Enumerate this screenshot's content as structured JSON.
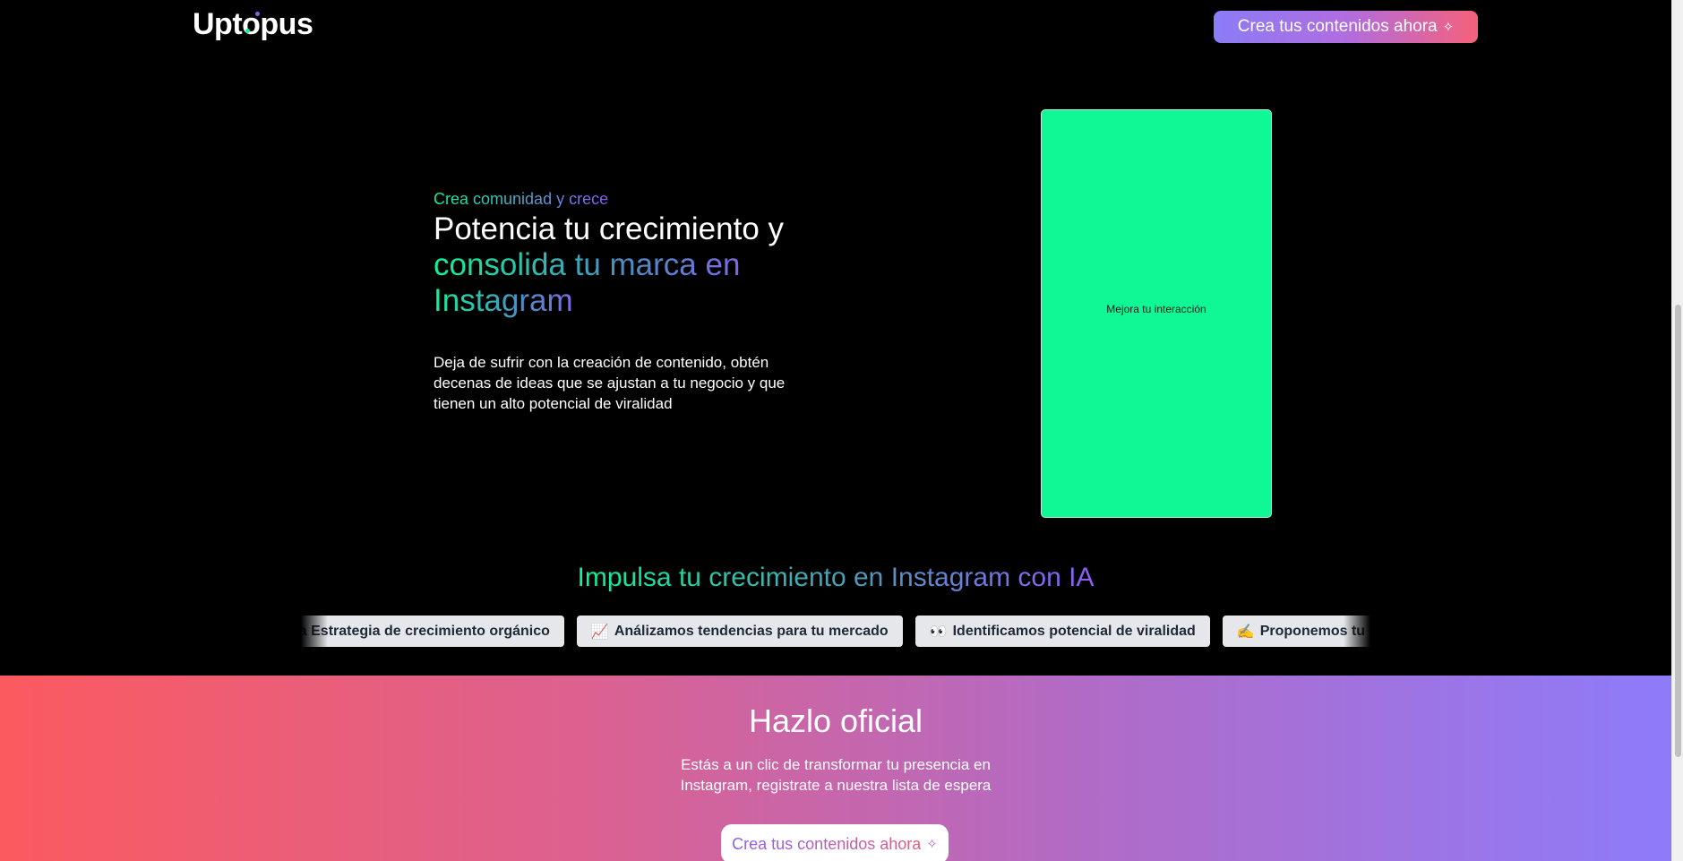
{
  "header": {
    "logo": "Uptopus",
    "cta_label": "Crea tus contenidos ahora",
    "cta_icon": "sparkles-icon"
  },
  "hero": {
    "kicker": "Crea comunidad y crece",
    "title_plain": "Potencia tu crecimiento y",
    "title_grad_line2": "consolida tu marca en",
    "title_grad_line3": "Instagram",
    "subtitle": "Deja de sufrir con la creación de contenido, obtén decenas de ideas que se ajustan a tu negocio y que tienen un alto potencial de viralidad",
    "phone_label": "Mejora tu interacción"
  },
  "features": {
    "title": "Impulsa tu crecimiento en Instagram con IA",
    "chips": [
      {
        "emoji": "",
        "label": "s la Estrategia de crecimiento orgánico"
      },
      {
        "emoji": "📈",
        "label": "Análizamos tendencias para tu mercado"
      },
      {
        "emoji": "👀",
        "label": "Identificamos potencial de viralidad"
      },
      {
        "emoji": "✍️",
        "label": "Proponemos tu"
      }
    ]
  },
  "cta_band": {
    "title": "Hazlo oficial",
    "subtitle": "Estás a un clic de transformar tu presencia en Instagram, registrate a nuestra lista de espera",
    "button_label": "Crea tus contenidos ahora"
  },
  "colors": {
    "background": "#000000",
    "accent_green": "#10f29a",
    "accent_purple": "#8b5cf6",
    "accent_red": "#fb5a5f"
  }
}
